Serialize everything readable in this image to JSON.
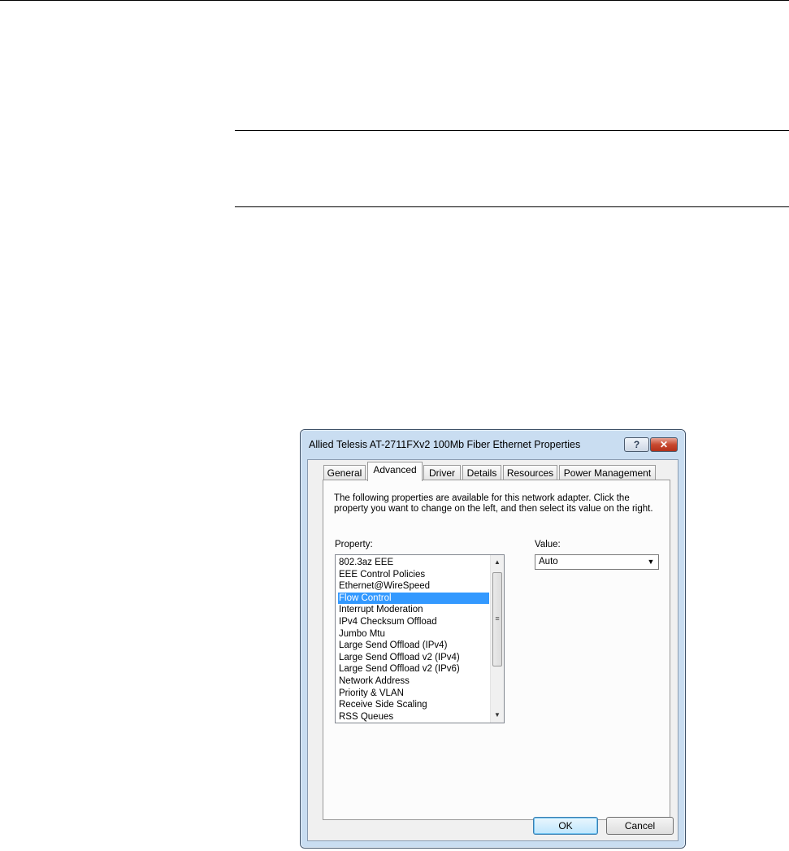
{
  "dialog": {
    "title": "Allied Telesis AT-2711FXv2 100Mb Fiber Ethernet Properties",
    "help_glyph": "?",
    "close_glyph": "✕",
    "tabs": [
      {
        "label": "General"
      },
      {
        "label": "Advanced",
        "active": true
      },
      {
        "label": "Driver"
      },
      {
        "label": "Details"
      },
      {
        "label": "Resources"
      },
      {
        "label": "Power Management"
      }
    ],
    "description": "The following properties are available for this network adapter. Click the property you want to change on the left, and then select its value on the right.",
    "property_label": "Property:",
    "value_label": "Value:",
    "properties": [
      "802.3az EEE",
      "EEE Control Policies",
      "Ethernet@WireSpeed",
      "Flow Control",
      "Interrupt Moderation",
      "IPv4 Checksum Offload",
      "Jumbo Mtu",
      "Large Send Offload (IPv4)",
      "Large Send Offload v2 (IPv4)",
      "Large Send Offload v2 (IPv6)",
      "Network Address",
      "Priority & VLAN",
      "Receive Side Scaling",
      "RSS Queues"
    ],
    "selected_property": "Flow Control",
    "value": "Auto",
    "ok_label": "OK",
    "cancel_label": "Cancel"
  },
  "colors": {
    "selection": "#3399ff",
    "window_frame": "#c9ddf1",
    "close_button": "#c8492f"
  }
}
